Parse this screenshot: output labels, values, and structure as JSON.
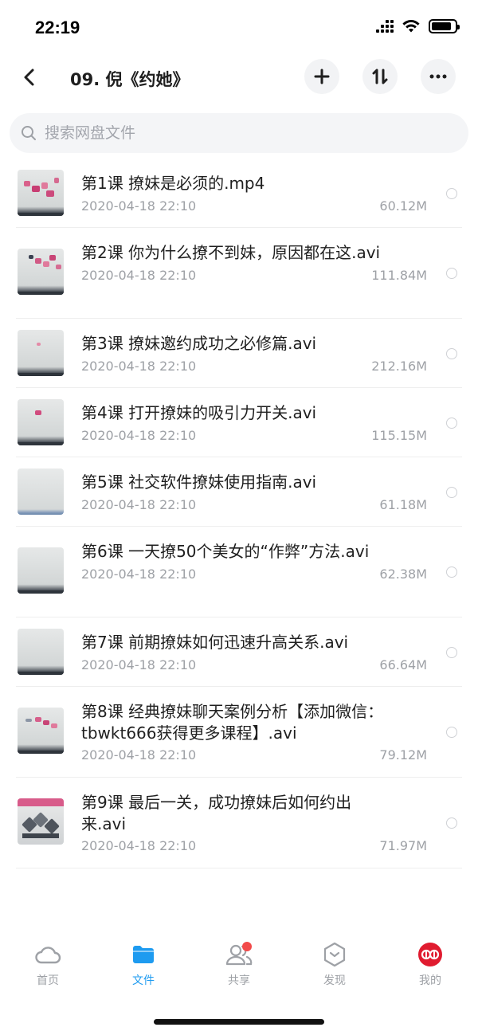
{
  "status": {
    "time": "22:19",
    "battery_level": 0.85
  },
  "header": {
    "title": "09. 倪《约她》"
  },
  "search": {
    "placeholder": "搜索网盘文件"
  },
  "files": [
    {
      "name": "第1课 撩妹是必须的.mp4",
      "date": "2020-04-18 22:10",
      "size": "60.12M"
    },
    {
      "name": "第2课 你为什么撩不到妹，原因都在这.avi",
      "date": "2020-04-18 22:10",
      "size": "111.84M"
    },
    {
      "name": "第3课 撩妹邀约成功之必修篇.avi",
      "date": "2020-04-18 22:10",
      "size": "212.16M"
    },
    {
      "name": "第4课 打开撩妹的吸引力开关.avi",
      "date": "2020-04-18 22:10",
      "size": "115.15M"
    },
    {
      "name": "第5课 社交软件撩妹使用指南.avi",
      "date": "2020-04-18 22:10",
      "size": "61.18M"
    },
    {
      "name": "第6课 一天撩50个美女的“作弊”方法.avi",
      "date": "2020-04-18 22:10",
      "size": "62.38M"
    },
    {
      "name": "第7课 前期撩妹如何迅速升高关系.avi",
      "date": "2020-04-18 22:10",
      "size": "66.64M"
    },
    {
      "name": "第8课 经典撩妹聊天案例分析【添加微信：tbwkt666获得更多课程】.avi",
      "date": "2020-04-18 22:10",
      "size": "79.12M"
    },
    {
      "name": "第9课 最后一关，成功撩妹后如何约出来.avi",
      "date": "2020-04-18 22:10",
      "size": "71.97M"
    }
  ],
  "tabs": [
    {
      "label": "首页",
      "icon": "cloud-icon"
    },
    {
      "label": "文件",
      "icon": "folder-icon",
      "active": true
    },
    {
      "label": "共享",
      "icon": "people-icon",
      "badge": true
    },
    {
      "label": "发现",
      "icon": "discover-icon"
    },
    {
      "label": "我的",
      "icon": "avatar-icon"
    }
  ],
  "colors": {
    "accent": "#1e9bf0",
    "badge": "#f24a4a",
    "text_secondary": "#9ea1a6"
  }
}
